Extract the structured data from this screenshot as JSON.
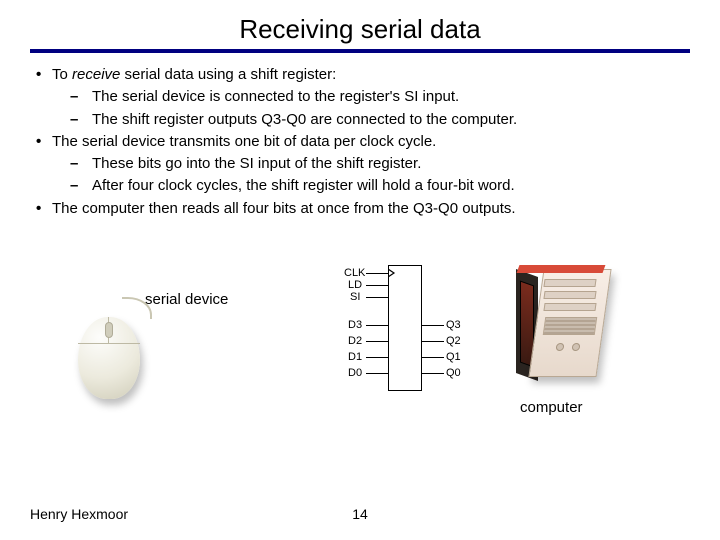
{
  "title": "Receiving serial data",
  "bullets": [
    {
      "text_before_italic": "To ",
      "italic": "receive",
      "text_after_italic": " serial data using a shift register:",
      "sub": [
        "The serial device is connected to the register's SI input.",
        "The shift register outputs Q3-Q0 are connected to the computer."
      ]
    },
    {
      "text": "The serial device transmits one bit of data per clock cycle.",
      "sub": [
        "These bits go into the SI input of the shift register.",
        "After four clock cycles, the shift register will hold a four-bit word."
      ]
    },
    {
      "text": "The computer then reads all four bits at once from the Q3-Q0 outputs.",
      "sub": []
    }
  ],
  "figure": {
    "serial_device_label": "serial device",
    "computer_label": "computer",
    "register": {
      "left_pins": [
        "CLK",
        "LD",
        "SI",
        "D3",
        "D2",
        "D1",
        "D0"
      ],
      "right_pins": [
        "Q3",
        "Q2",
        "Q1",
        "Q0"
      ]
    }
  },
  "footer": {
    "author": "Henry Hexmoor",
    "page": "14"
  }
}
